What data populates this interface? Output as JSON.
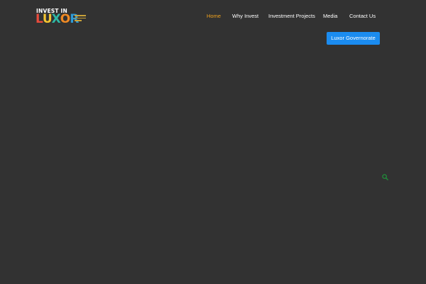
{
  "logo": {
    "top_text": "INVEST IN",
    "word_letters": [
      "L",
      "U",
      "X",
      "O",
      "R"
    ],
    "letter_colors": [
      "#e94b3c",
      "#f4c430",
      "#2eb8a5",
      "#f08a24",
      "#2e9bd6"
    ],
    "icon": "invest-in-luxor-logo"
  },
  "nav": {
    "items": [
      {
        "label": "Home",
        "active": true
      },
      {
        "label": "Why Invest",
        "active": false
      },
      {
        "label": "Investment Projects",
        "active": false
      },
      {
        "label": "Media",
        "active": false
      },
      {
        "label": "Contact Us",
        "active": false
      }
    ],
    "language_icon": "uk-flag-icon"
  },
  "cta": {
    "label": "Luxor Governorate"
  },
  "search": {
    "icon": "search-icon"
  },
  "colors": {
    "background": "#323232",
    "nav_text": "#ffffff",
    "nav_active": "#f0a21d",
    "button_bg": "#1b8cf0",
    "search_icon": "#1f8f3a"
  }
}
